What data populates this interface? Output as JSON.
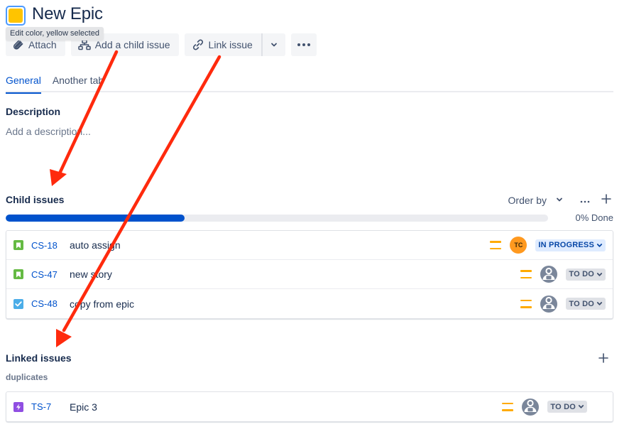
{
  "header": {
    "title": "New Epic",
    "epic_color": "#ffc400",
    "color_tooltip": "Edit color, yellow selected"
  },
  "toolbar": {
    "attach_label": "Attach",
    "add_child_label": "Add a child issue",
    "link_issue_label": "Link issue"
  },
  "tabs": [
    {
      "label": "General",
      "active": true
    },
    {
      "label": "Another tab",
      "active": false
    }
  ],
  "description": {
    "heading": "Description",
    "placeholder": "Add a description..."
  },
  "child_issues": {
    "heading": "Child issues",
    "order_by_label": "Order by",
    "progress_in_progress_fraction": 0.33,
    "done_label": "0% Done",
    "items": [
      {
        "type": "story",
        "key": "CS-18",
        "summary": "auto assign",
        "priority": "medium",
        "assignee_initials": "TC",
        "status": "IN PROGRESS"
      },
      {
        "type": "story",
        "key": "CS-47",
        "summary": "new story",
        "priority": "medium",
        "assignee_initials": "",
        "status": "TO DO"
      },
      {
        "type": "task",
        "key": "CS-48",
        "summary": "copy from epic",
        "priority": "medium",
        "assignee_initials": "",
        "status": "TO DO"
      }
    ]
  },
  "linked_issues": {
    "heading": "Linked issues",
    "group_label": "duplicates",
    "items": [
      {
        "type": "epic",
        "key": "TS-7",
        "summary": "Epic 3",
        "priority": "medium",
        "assignee_initials": "",
        "status": "TO DO"
      }
    ]
  },
  "colors": {
    "story": "#65ba43",
    "task": "#4bade8",
    "epic": "#904ee2",
    "link": "#0052cc",
    "priority_medium": "#ffab00",
    "annotation_arrow": "#ff2a0d"
  }
}
